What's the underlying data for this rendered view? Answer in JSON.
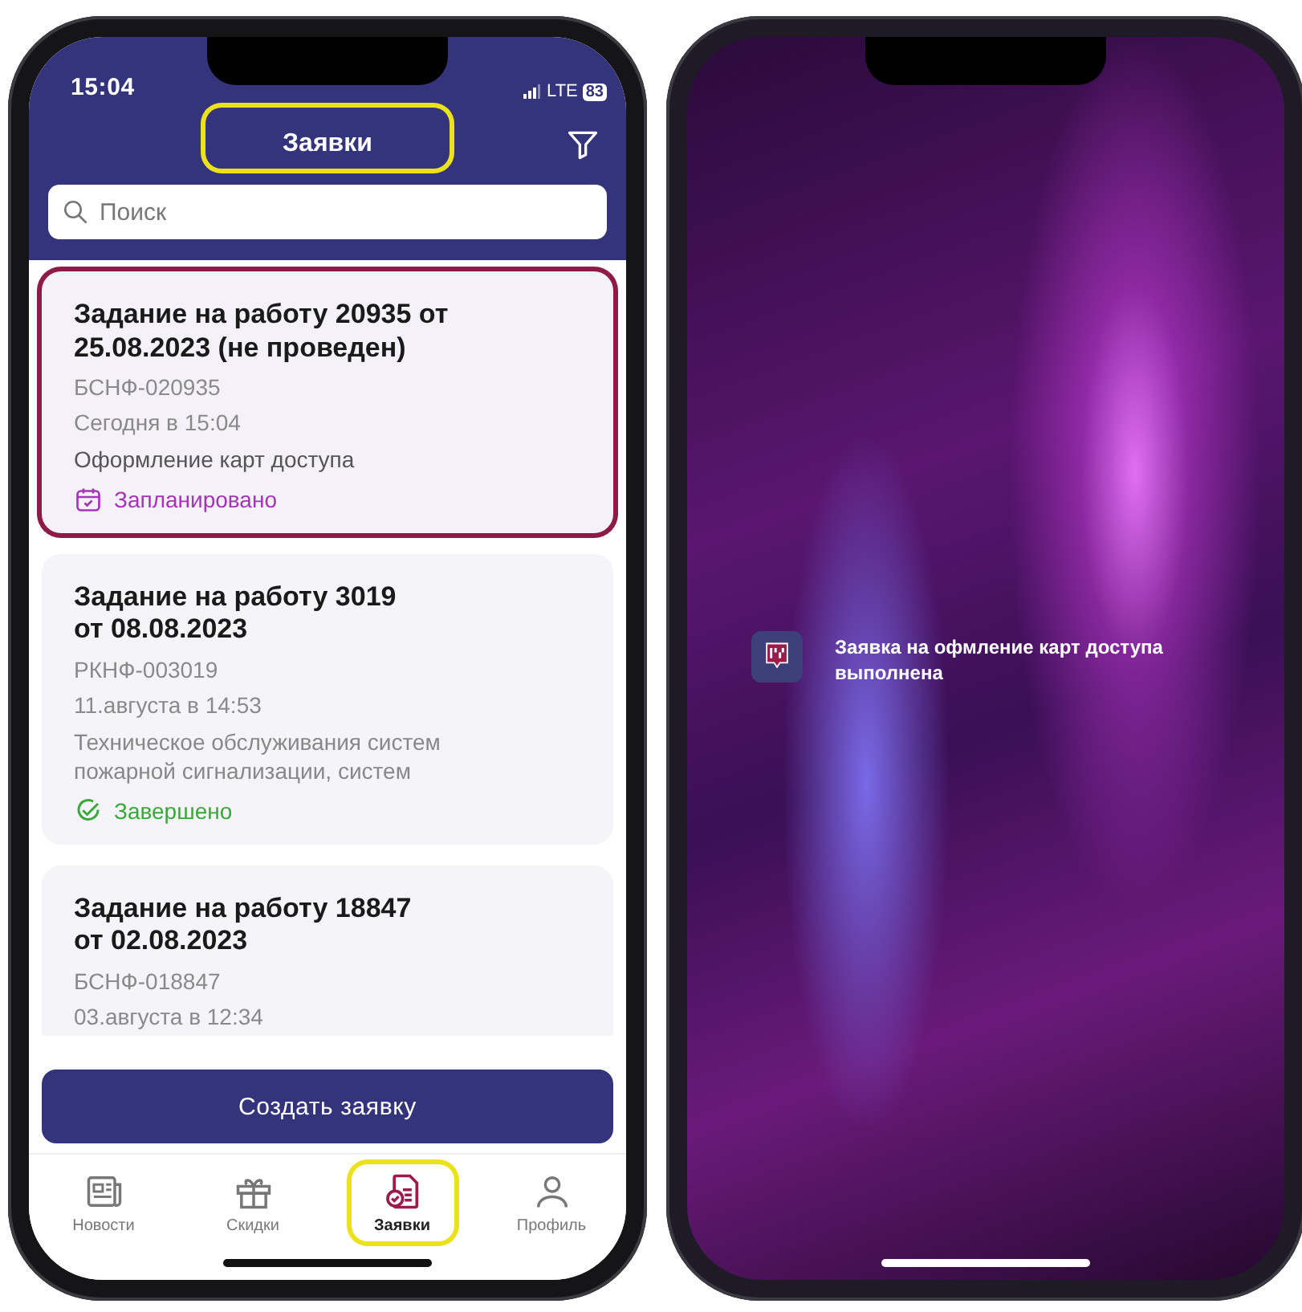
{
  "app_screen": {
    "status_bar": {
      "time": "15:04",
      "network": "LTE",
      "battery": "83"
    },
    "header": {
      "title": "Заявки",
      "highlighted": true
    },
    "search": {
      "placeholder": "Поиск"
    },
    "cards": [
      {
        "title": "Задание на работу 20935 от\n25.08.2023 (не проведен)",
        "code": "БСНФ-020935",
        "date": "Сегодня в 15:04",
        "description": "Оформление карт доступа",
        "status": {
          "kind": "planned",
          "label": "Запланировано"
        },
        "selected": true
      },
      {
        "title": "Задание на работу 3019\nот 08.08.2023",
        "code": "РКНФ-003019",
        "date": "11.августа в 14:53",
        "description": "Техническое обслуживания систем\nпожарной сигнализации, систем",
        "status": {
          "kind": "done",
          "label": "Завершено"
        },
        "selected": false
      },
      {
        "title": "Задание на работу 18847\nот 02.08.2023",
        "code": "БСНФ-018847",
        "date": "03.августа в 12:34",
        "selected": false
      }
    ],
    "create_button": "Создать заявку",
    "nav": [
      {
        "kind": "news",
        "label": "Новости",
        "selected": false,
        "highlighted": false
      },
      {
        "kind": "discounts",
        "label": "Скидки",
        "selected": false,
        "highlighted": false
      },
      {
        "kind": "requests",
        "label": "Заявки",
        "selected": true,
        "highlighted": true
      },
      {
        "kind": "profile",
        "label": "Профиль",
        "selected": false,
        "highlighted": false
      }
    ]
  },
  "lock_screen": {
    "notification": {
      "text": "Заявка на офмление карт доступа\nвыполнена"
    }
  }
}
